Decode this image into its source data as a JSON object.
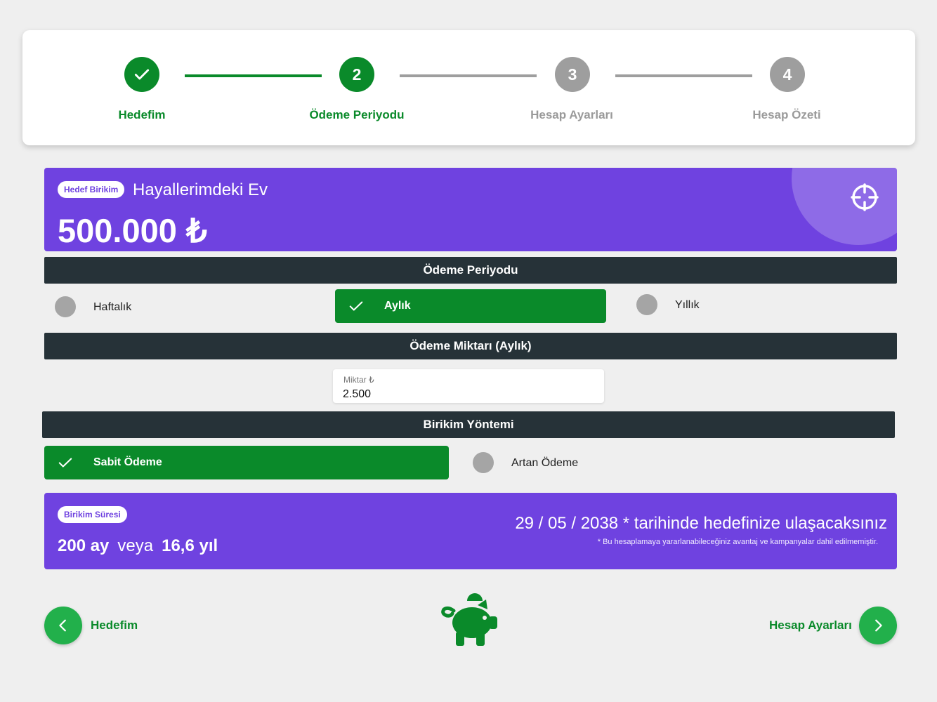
{
  "stepper": {
    "steps": [
      {
        "number": "",
        "label": "Hedefim",
        "state": "completed"
      },
      {
        "number": "2",
        "label": "Ödeme Periyodu",
        "state": "active"
      },
      {
        "number": "3",
        "label": "Hesap Ayarları",
        "state": "pending"
      },
      {
        "number": "4",
        "label": "Hesap Özeti",
        "state": "pending"
      }
    ]
  },
  "goal": {
    "badge": "Hedef Birikim",
    "name": "Hayallerimdeki Ev",
    "amount": "500.000 ₺",
    "icon": "target-icon"
  },
  "payment_period": {
    "title": "Ödeme Periyodu",
    "options": [
      {
        "label": "Haftalık",
        "selected": false
      },
      {
        "label": "Aylık",
        "selected": true
      },
      {
        "label": "Yıllık",
        "selected": false
      }
    ]
  },
  "payment_amount": {
    "title": "Ödeme Miktarı (Aylık)",
    "field_label": "Miktar ₺",
    "value": "2.500"
  },
  "saving_method": {
    "title": "Birikim Yöntemi",
    "options": [
      {
        "label": "Sabit Ödeme",
        "selected": true
      },
      {
        "label": "Artan Ödeme",
        "selected": false
      }
    ]
  },
  "duration": {
    "badge": "Birikim Süresi",
    "months": "200 ay",
    "or": "veya",
    "years": "16,6 yıl",
    "target_date_text": "29 / 05 / 2038 * tarihinde hedefinize ulaşacaksınız",
    "disclaimer": "* Bu hesaplamaya yararlanabileceğiniz avantaj ve kampanyalar dahil edilmemiştir."
  },
  "navigation": {
    "back_label": "Hedefim",
    "next_label": "Hesap Ayarları",
    "center_icon": "piggy-bank-icon"
  },
  "colors": {
    "green": "#0a8a2a",
    "button_green": "#22b04b",
    "purple": "#6f42e0",
    "dark_header": "#263238",
    "inactive_gray": "#9e9e9e"
  }
}
